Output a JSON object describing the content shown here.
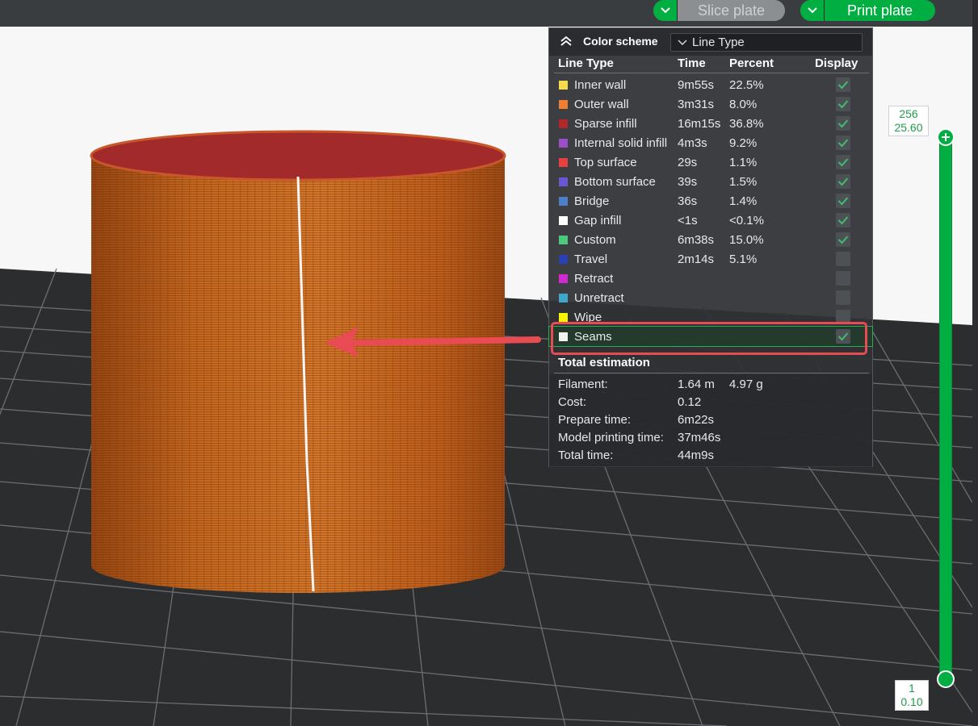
{
  "toolbar": {
    "slice_label": "Slice plate",
    "print_label": "Print plate",
    "icons": [
      "chevron-down-icon",
      "chevron-down-icon"
    ],
    "accent": "#00ae42"
  },
  "legend": {
    "color_scheme_label": "Color scheme",
    "color_scheme_value": "Line Type",
    "headers": {
      "line_type": "Line Type",
      "time": "Time",
      "percent": "Percent",
      "display": "Display"
    },
    "rows": [
      {
        "name": "Inner wall",
        "time": "9m55s",
        "percent": "22.5%",
        "color": "#f7d94a",
        "display": true
      },
      {
        "name": "Outer wall",
        "time": "3m31s",
        "percent": "8.0%",
        "color": "#ef7f31",
        "display": true
      },
      {
        "name": "Sparse infill",
        "time": "16m15s",
        "percent": "36.8%",
        "color": "#b0282a",
        "display": true
      },
      {
        "name": "Internal solid infill",
        "time": "4m3s",
        "percent": "9.2%",
        "color": "#9a4fc7",
        "display": true
      },
      {
        "name": "Top surface",
        "time": "29s",
        "percent": "1.1%",
        "color": "#e84040",
        "display": true
      },
      {
        "name": "Bottom surface",
        "time": "39s",
        "percent": "1.5%",
        "color": "#6a55d4",
        "display": true
      },
      {
        "name": "Bridge",
        "time": "36s",
        "percent": "1.4%",
        "color": "#4f7fc7",
        "display": true
      },
      {
        "name": "Gap infill",
        "time": "<1s",
        "percent": "<0.1%",
        "color": "#ffffff",
        "display": true
      },
      {
        "name": "Custom",
        "time": "6m38s",
        "percent": "15.0%",
        "color": "#4cc97a",
        "display": true
      },
      {
        "name": "Travel",
        "time": "2m14s",
        "percent": "5.1%",
        "color": "#2b3fb5",
        "display": false
      },
      {
        "name": "Retract",
        "time": "",
        "percent": "",
        "color": "#d12ad1",
        "display": false
      },
      {
        "name": "Unretract",
        "time": "",
        "percent": "",
        "color": "#3fa7c9",
        "display": false
      },
      {
        "name": "Wipe",
        "time": "",
        "percent": "",
        "color": "#f5f500",
        "display": false
      },
      {
        "name": "Seams",
        "time": "",
        "percent": "",
        "color": "#f2f2f2",
        "display": true
      }
    ],
    "total_title": "Total estimation",
    "totals": [
      {
        "key": "Filament:",
        "value": "1.64 m",
        "value2": "4.97 g"
      },
      {
        "key": "Cost:",
        "value": "0.12",
        "value2": ""
      },
      {
        "key": "Prepare time:",
        "value": "6m22s",
        "value2": ""
      },
      {
        "key": "Model printing time:",
        "value": "37m46s",
        "value2": ""
      },
      {
        "key": "Total time:",
        "value": "44m9s",
        "value2": ""
      }
    ]
  },
  "slider": {
    "top_layer": "256",
    "top_height": "25.60",
    "bottom_layer": "1",
    "bottom_height": "0.10"
  },
  "viewport": {
    "model_color": "#c0601f",
    "top_color": "#a32a2a",
    "seam_color": "#f5f5f5",
    "arrow_color": "#e84b52"
  }
}
